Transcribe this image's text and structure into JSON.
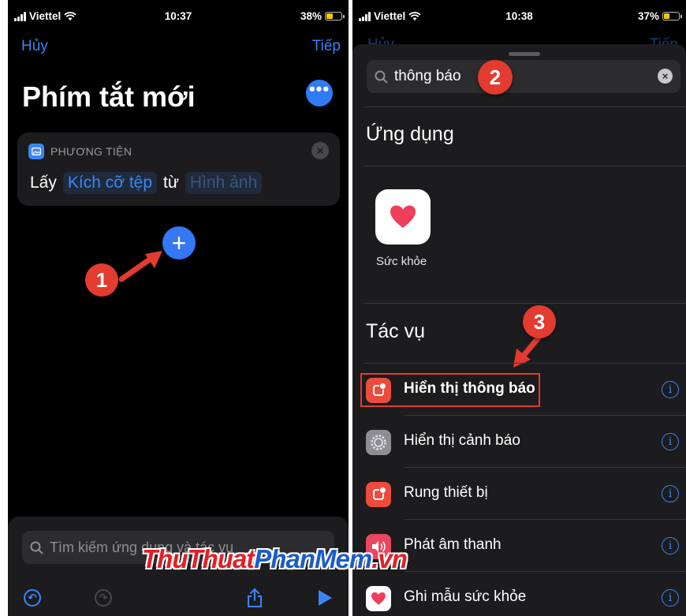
{
  "left_phone": {
    "status": {
      "carrier": "Viettel",
      "time": "10:37",
      "battery": "38%",
      "battery_level": 0.38
    },
    "nav": {
      "cancel": "Hủy",
      "next": "Tiếp"
    },
    "title": "Phím tắt mới",
    "action_card": {
      "category": "PHƯƠNG TIỆN",
      "verb": "Lấy",
      "param": "Kích cỡ tệp",
      "connector": "từ",
      "source": "Hình ảnh"
    },
    "search": {
      "placeholder": "Tìm kiếm ứng dụng và tác vụ"
    },
    "callout": "1"
  },
  "right_phone": {
    "status": {
      "carrier": "Viettel",
      "time": "10:38",
      "battery": "37%",
      "battery_level": 0.37
    },
    "nav": {
      "cancel": "Hủy",
      "next": "Tiếp"
    },
    "search": {
      "value": "thông báo"
    },
    "callout_search": "2",
    "apps_title": "Ứng dụng",
    "apps": [
      {
        "label": "Sức khỏe",
        "icon": "heart-icon"
      }
    ],
    "actions_title": "Tác vụ",
    "callout_action": "3",
    "actions": [
      {
        "label": "Hiển thị thông báo",
        "icon": "notification-icon",
        "color": "#ec4b3d"
      },
      {
        "label": "Hiển thị cảnh báo",
        "icon": "settings-gear-icon",
        "color": "#8e8e93"
      },
      {
        "label": "Rung thiết bị",
        "icon": "notification-icon",
        "color": "#ec4b3d"
      },
      {
        "label": "Phát âm thanh",
        "icon": "speaker-icon",
        "color": "#ea4660"
      },
      {
        "label": "Ghi mẫu sức khỏe",
        "icon": "heart-icon",
        "color": "#ffffff"
      }
    ]
  },
  "watermark": {
    "part1": "ThuThuat",
    "part2": "PhanMem",
    "part3": ".vn"
  },
  "colors": {
    "accent": "#3478f6",
    "callout": "#e33b30",
    "background": "#000000",
    "card": "#1c1c1e"
  }
}
